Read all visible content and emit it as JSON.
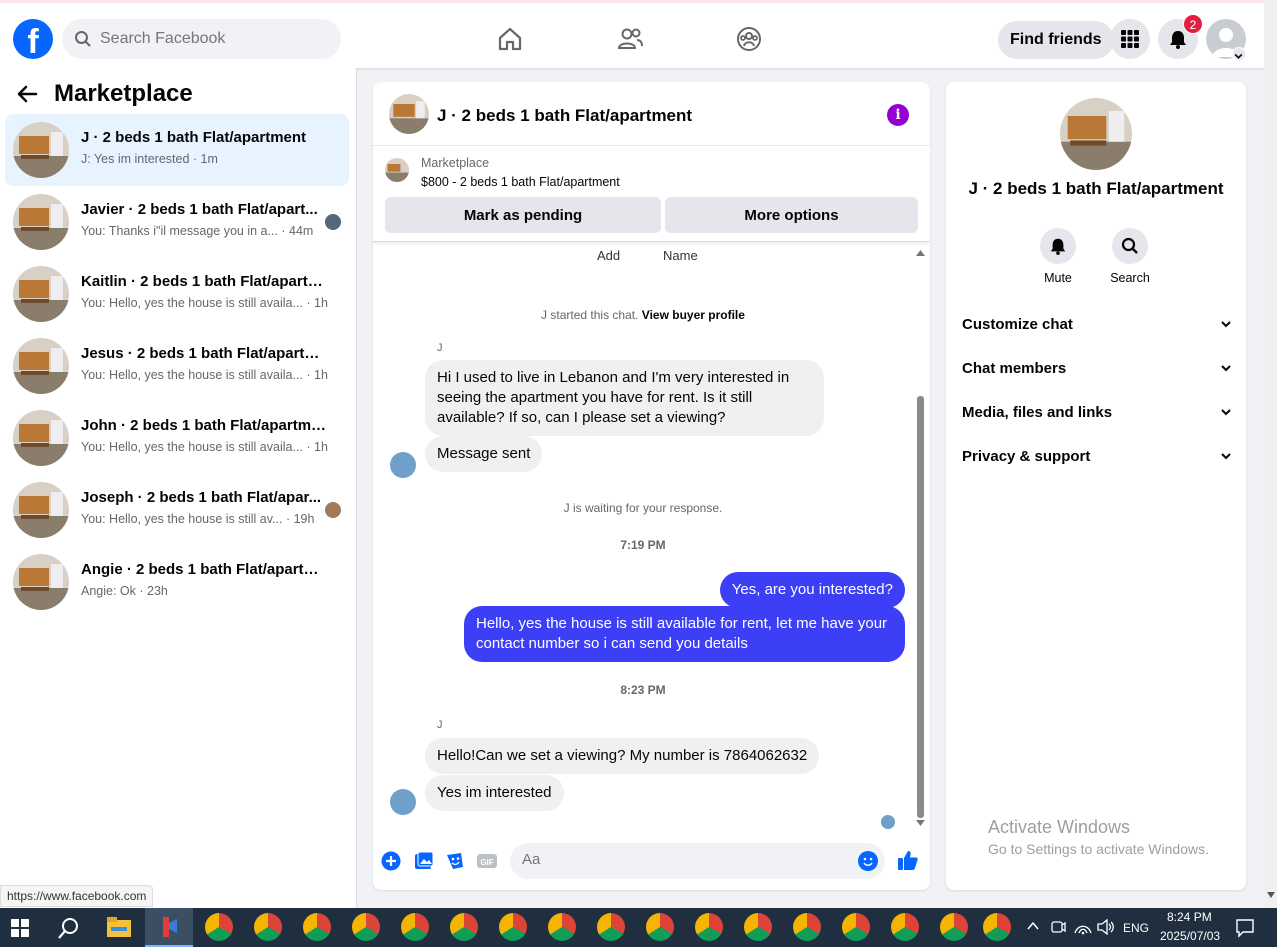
{
  "topnav": {
    "search_placeholder": "Search Facebook",
    "find_friends": "Find friends",
    "notif_count": "2",
    "icons": [
      "home-icon",
      "friends-icon",
      "groups-icon",
      "apps-grid-icon",
      "bell-icon"
    ]
  },
  "sidebar": {
    "title": "Marketplace",
    "conversations": [
      {
        "name": "J · 2 beds 1 bath Flat/apartment",
        "snippet": "J: Yes im interested · 1m",
        "active": true
      },
      {
        "name": "Javier · 2 beds 1 bath Flat/apart...",
        "snippet": "You: Thanks i\"il message you in a... · 44m"
      },
      {
        "name": "Kaitlin · 2 beds 1 bath Flat/apartm...",
        "snippet": "You: Hello, yes the house is still availa... · 1h"
      },
      {
        "name": "Jesus · 2 beds 1 bath Flat/apartment",
        "snippet": "You: Hello, yes the house is still availa... · 1h"
      },
      {
        "name": "John · 2 beds 1 bath Flat/apartment",
        "snippet": "You: Hello, yes the house is still availa... · 1h"
      },
      {
        "name": "Joseph · 2 beds 1 bath Flat/apar...",
        "snippet": "You: Hello, yes the house is still av... · 19h"
      },
      {
        "name": "Angie · 2 beds 1 bath Flat/apartme...",
        "snippet": "Angie: Ok · 23h"
      }
    ]
  },
  "chat": {
    "title": "J · 2 beds 1 bath Flat/apartment",
    "marketplace_label": "Marketplace",
    "listing": "$800 - 2 beds 1 bath Flat/apartment",
    "mark_pending": "Mark as pending",
    "more_options": "More options",
    "add_label": "Add",
    "name_label": "Name",
    "started_text": "J started this chat.",
    "view_buyer": "View buyer profile",
    "sender": "J",
    "msg1": "Hi I used to live in Lebanon and I'm very interested in seeing the apartment you have for rent. Is it still available? If so, can I please set a viewing?",
    "msg2": "Message sent",
    "waiting": "J is waiting for your response.",
    "time1": "7:19 PM",
    "out1": "Yes, are you interested?",
    "out2": "Hello, yes the house is still available for rent, let me have your contact number so i can send you details",
    "time2": "8:23 PM",
    "msg3": "Hello!Can we set a viewing? My number is 7864062632",
    "msg4": "Yes im interested",
    "composer_placeholder": "Aa"
  },
  "right_panel": {
    "title": "J · 2 beds 1 bath Flat/apartment",
    "mute": "Mute",
    "search": "Search",
    "rows": [
      "Customize chat",
      "Chat members",
      "Media, files and links",
      "Privacy & support"
    ]
  },
  "status_url": "https://www.facebook.com",
  "watermark": {
    "line1": "Activate Windows",
    "line2": "Go to Settings to activate Windows."
  },
  "taskbar": {
    "lang": "ENG",
    "time": "8:24 PM",
    "date": "2025/07/03"
  },
  "colors": {
    "brand": "#0866ff",
    "outgoing_bubble": "#3c3ff6",
    "active_conversation": "#e7f3ff",
    "badge": "#e41e3f"
  }
}
